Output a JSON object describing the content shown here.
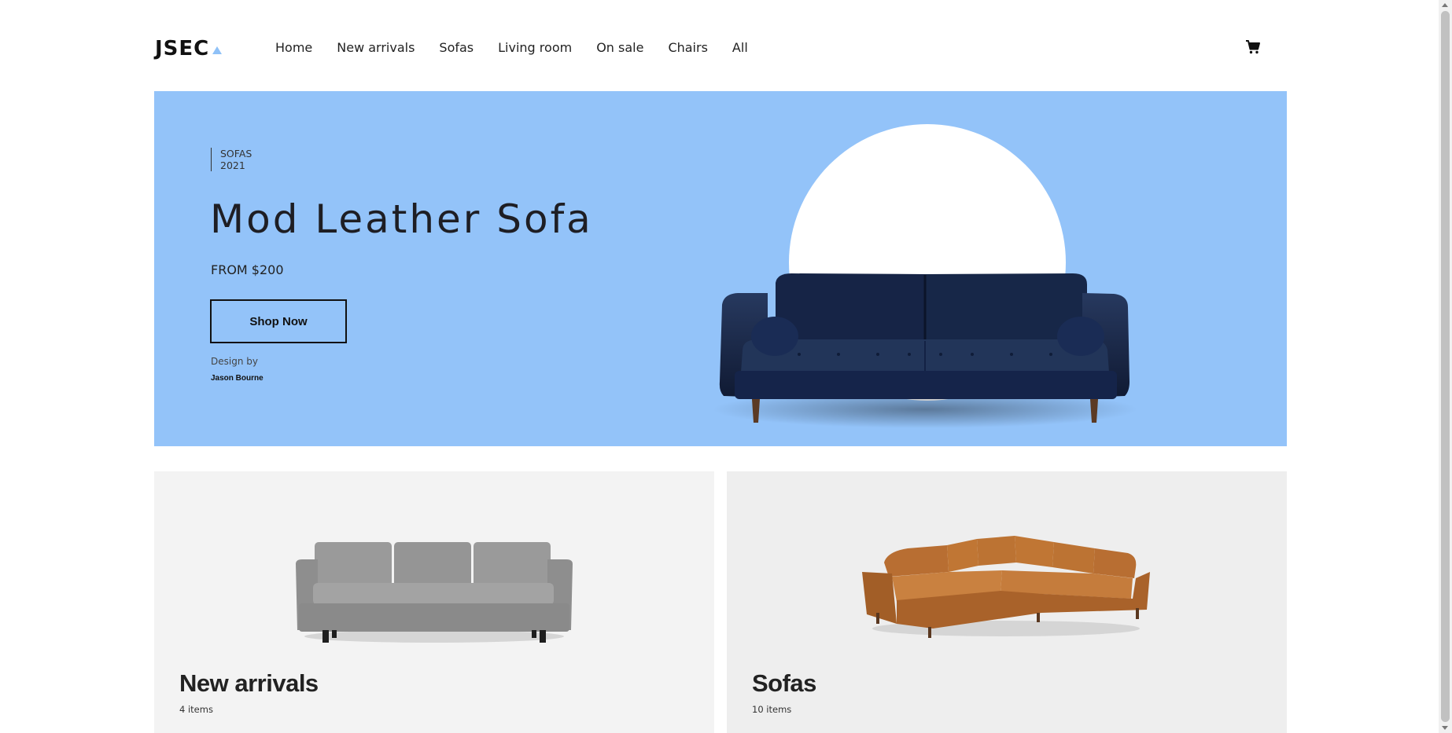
{
  "header": {
    "logo_text": "JSEC",
    "nav": [
      "Home",
      "New arrivals",
      "Sofas",
      "Living room",
      "On sale",
      "Chairs",
      "All"
    ],
    "cart_icon": "shopping-cart-icon"
  },
  "hero": {
    "tag_line1": "SOFAS",
    "tag_line2": "2021",
    "title": "Mod Leather Sofa",
    "price": "FROM $200",
    "cta_label": "Shop Now",
    "design_by_label": "Design by",
    "designer": "Jason Bourne",
    "background_color": "#93c3f9",
    "product_color": "#1b2a4e"
  },
  "categories": [
    {
      "title": "New arrivals",
      "count": "4 items",
      "image": "grey-sofa"
    },
    {
      "title": "Sofas",
      "count": "10 items",
      "image": "tan-sectional-sofa"
    }
  ]
}
